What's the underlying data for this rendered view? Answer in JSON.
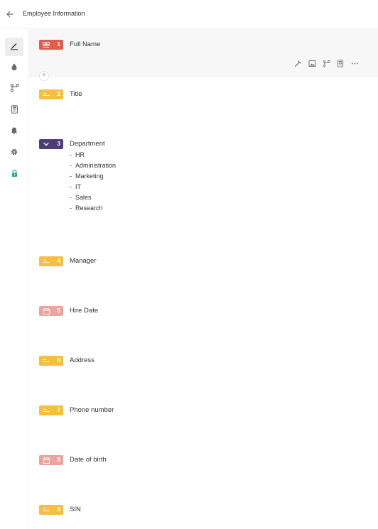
{
  "header": {
    "title": "Employee Information"
  },
  "sidebar": {
    "items": [
      {
        "icon": "pencil-icon"
      },
      {
        "icon": "drop-icon"
      },
      {
        "icon": "branch-icon"
      },
      {
        "icon": "calculator-icon"
      },
      {
        "icon": "bell-icon"
      },
      {
        "icon": "gear-icon"
      },
      {
        "icon": "lock-icon",
        "color": "#2aa39a"
      }
    ]
  },
  "colors": {
    "name_field": "#e25b4b",
    "text_field": "#f6bf3f",
    "dropdown_field": "#4e3b78",
    "date_field": "#eda3a0",
    "selected_row_bg": "#f7f7f7"
  },
  "row_tools": [
    "wrench-icon",
    "image-icon",
    "branch-icon",
    "calculator-icon",
    "more-icon"
  ],
  "add_button": "+",
  "fields": [
    {
      "number": "1",
      "label": "Full Name",
      "type": "name"
    },
    {
      "number": "2",
      "label": "Title",
      "type": "text"
    },
    {
      "number": "3",
      "label": "Department",
      "type": "dropdown",
      "options": [
        "HR",
        "Administration",
        "Marketing",
        "IT",
        "Sales",
        "Research"
      ]
    },
    {
      "number": "4",
      "label": "Manager",
      "type": "text"
    },
    {
      "number": "5",
      "label": "Hire Date",
      "type": "date"
    },
    {
      "number": "6",
      "label": "Address",
      "type": "text"
    },
    {
      "number": "7",
      "label": "Phone number",
      "type": "text"
    },
    {
      "number": "8",
      "label": "Date of birth",
      "type": "date"
    },
    {
      "number": "9",
      "label": "SIN",
      "type": "text"
    }
  ]
}
